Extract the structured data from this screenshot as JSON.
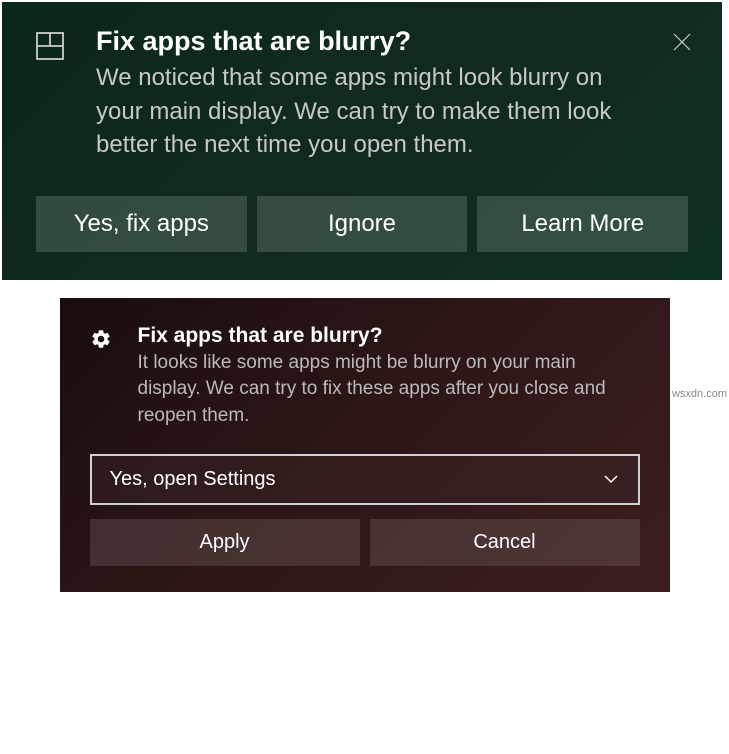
{
  "notification1": {
    "title": "Fix apps that are blurry?",
    "message": "We noticed that some apps might look blurry on your main display. We can try to make them look better the next time you open them.",
    "buttons": {
      "yes": "Yes, fix apps",
      "ignore": "Ignore",
      "learn": "Learn More"
    }
  },
  "notification2": {
    "title": "Fix apps that are blurry?",
    "message": "It looks like some apps might be blurry on your main display. We can try to fix these apps after you close and reopen them.",
    "dropdown": {
      "selected": "Yes, open Settings"
    },
    "buttons": {
      "apply": "Apply",
      "cancel": "Cancel"
    }
  },
  "watermark": "wsxdn.com"
}
